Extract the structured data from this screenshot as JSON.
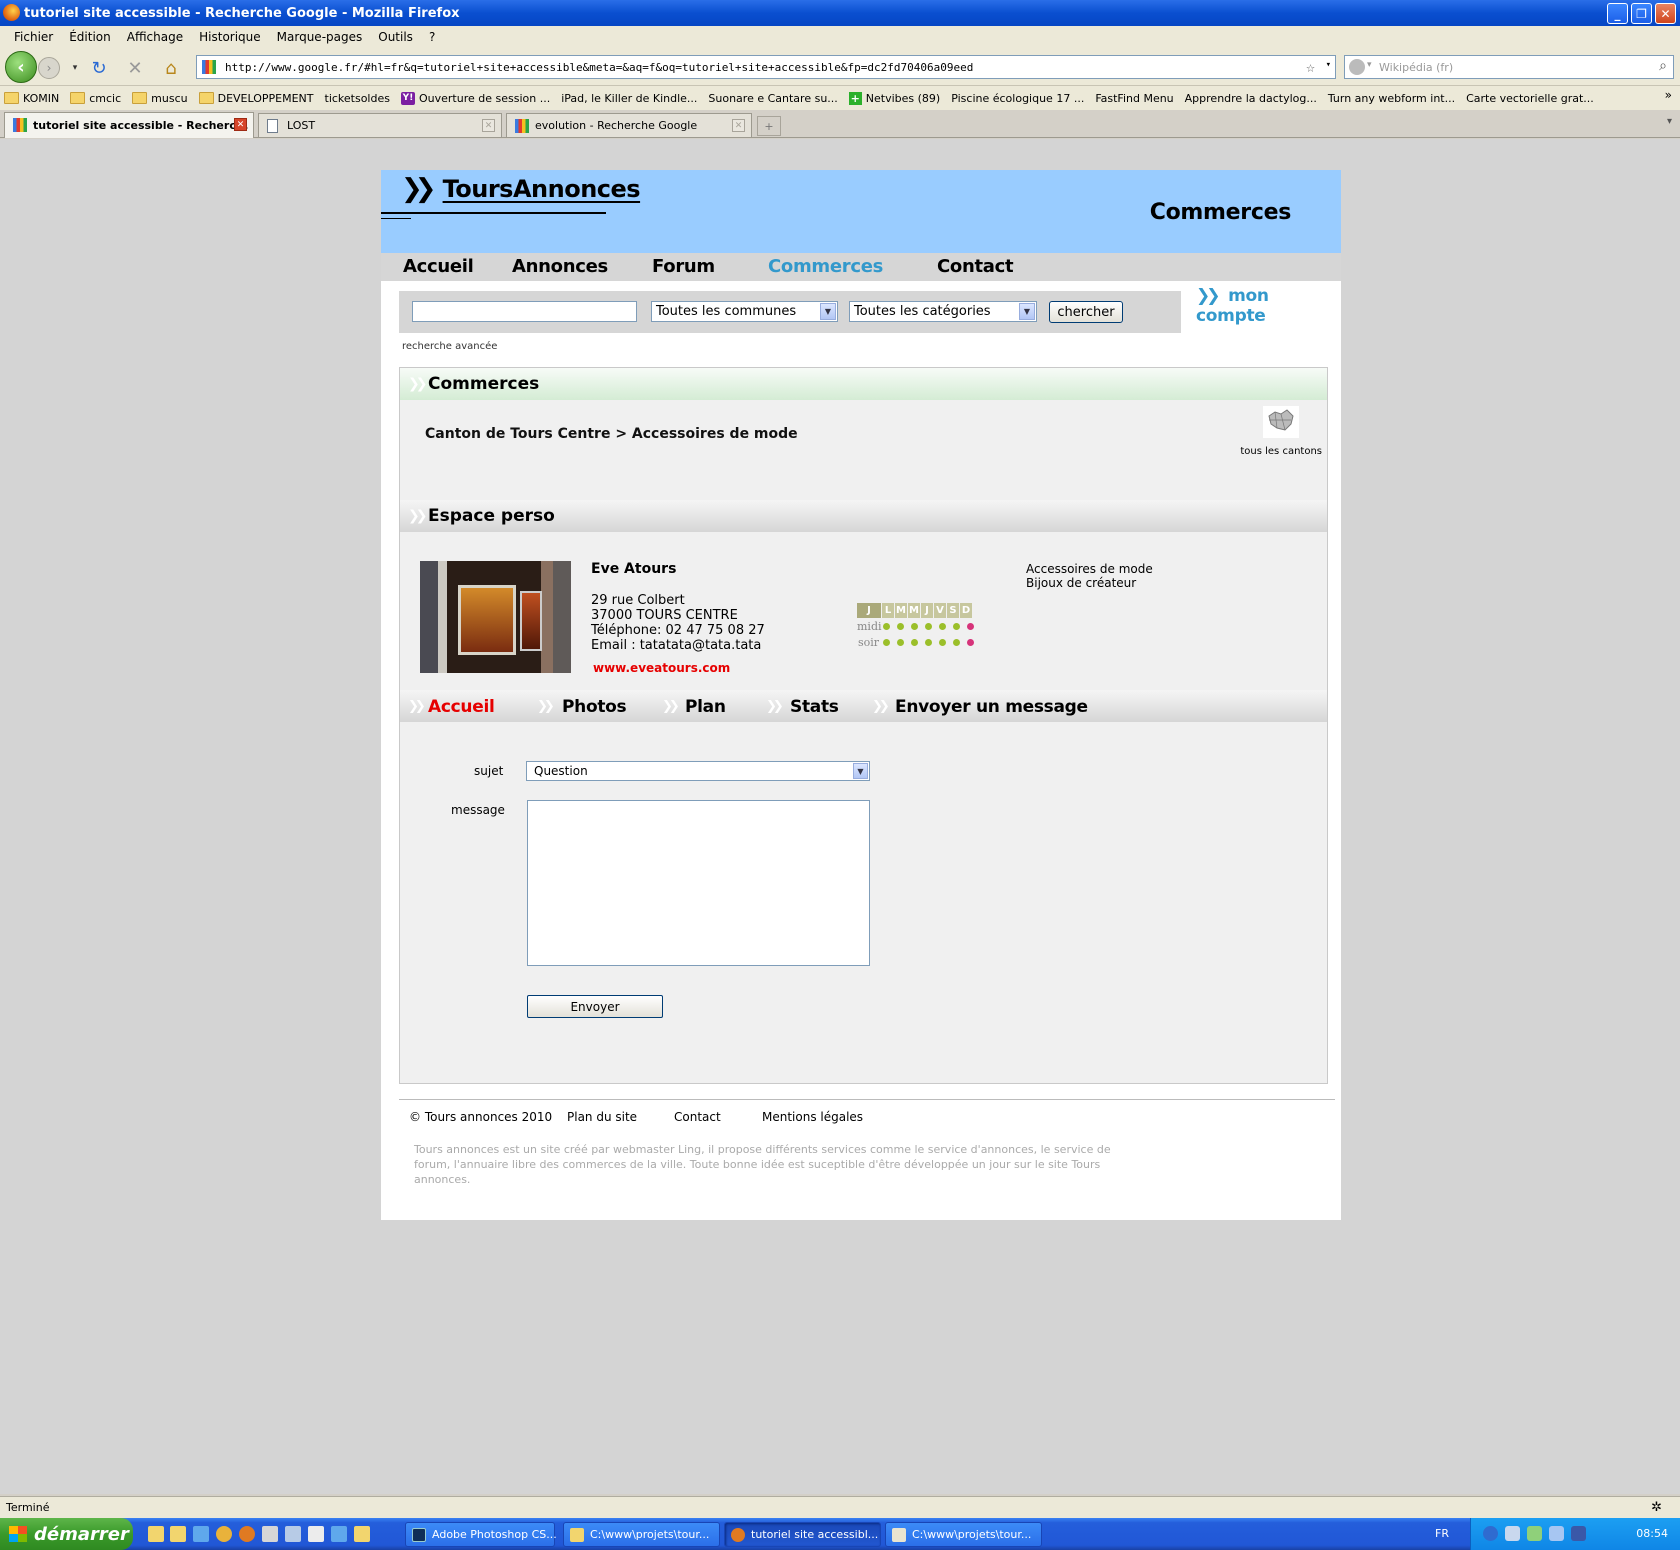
{
  "window": {
    "title": "tutoriel site accessible - Recherche Google - Mozilla Firefox"
  },
  "menu": [
    "Fichier",
    "Édition",
    "Affichage",
    "Historique",
    "Marque-pages",
    "Outils",
    "?"
  ],
  "url": "http://www.google.fr/#hl=fr&q=tutoriel+site+accessible&meta=&aq=f&oq=tutoriel+site+accessible&fp=dc2fd70406a09eed",
  "search_placeholder": "Wikipédia (fr)",
  "bookmarks": [
    {
      "label": "KOMIN",
      "icon": "folder-icon"
    },
    {
      "label": "cmcic",
      "icon": "folder-icon"
    },
    {
      "label": "muscu",
      "icon": "folder-icon"
    },
    {
      "label": "DEVELOPPEMENT",
      "icon": "folder-icon"
    },
    {
      "label": "ticketsoldes",
      "icon": "page-icon"
    },
    {
      "label": "Ouverture de session ...",
      "icon": "yahoo-icon"
    },
    {
      "label": "iPad, le Killer de Kindle...",
      "icon": "page-icon"
    },
    {
      "label": "Suonare e Cantare su...",
      "icon": "page-icon"
    },
    {
      "label": "Netvibes (89)",
      "icon": "netvibes-icon"
    },
    {
      "label": "Piscine écologique 17 ...",
      "icon": "page-icon"
    },
    {
      "label": "FastFind Menu",
      "icon": "page-icon"
    },
    {
      "label": "Apprendre la dactylog...",
      "icon": "page-icon"
    },
    {
      "label": "Turn any webform int...",
      "icon": "page-icon"
    },
    {
      "label": "Carte vectorielle grat...",
      "icon": "page-icon"
    }
  ],
  "tabs": [
    {
      "label": "tutoriel site accessible - Recherc...",
      "active": true
    },
    {
      "label": "LOST",
      "active": false
    },
    {
      "label": "evolution - Recherche Google",
      "active": false
    }
  ],
  "site": {
    "logo": "ToursAnnonces",
    "header_title": "Commerces",
    "nav": [
      "Accueil",
      "Annonces",
      "Forum",
      "Commerces",
      "Contact"
    ],
    "nav_active": "Commerces",
    "search": {
      "commune": "Toutes les communes",
      "category": "Toutes les catégories",
      "button": "chercher"
    },
    "account": "mon compte",
    "advanced_search": "recherche avancée",
    "section1_title": "Commerces",
    "breadcrumb": "Canton de Tours Centre > Accessoires de mode",
    "all_cantons": "tous les cantons",
    "section2_title": "Espace perso",
    "shop": {
      "name": "Eve Atours",
      "address1": "29 rue Colbert",
      "address2": "37000 TOURS CENTRE",
      "phone": "Téléphone: 02 47 75 08 27",
      "email": "Email : tatatata@tata.tata",
      "website": "www.eveatours.com",
      "categories": [
        "Accessoires de mode",
        "Bijoux de créateur"
      ]
    },
    "hours": {
      "days": [
        "J",
        "L",
        "M",
        "M",
        "J",
        "V",
        "S",
        "D"
      ],
      "rows": [
        "midi",
        "soir"
      ]
    },
    "shop_tabs": [
      "Accueil",
      "Photos",
      "Plan",
      "Stats",
      "Envoyer un message"
    ],
    "shop_tab_active": "Accueil",
    "form": {
      "subject_label": "sujet",
      "subject_value": "Question",
      "message_label": "message",
      "submit": "Envoyer"
    },
    "footer": {
      "copyright": "© Tours annonces 2010",
      "links": [
        "Plan du site",
        "Contact",
        "Mentions légales"
      ],
      "text": "Tours annonces est un site créé par webmaster Ling, il propose différents services comme le service d'annonces, le service de forum, l'annuaire libre des commerces de la ville. Toute bonne idée est suceptible d'être développée un jour sur le site Tours annonces."
    }
  },
  "status": "Terminé",
  "taskbar": {
    "start": "démarrer",
    "tasks": [
      {
        "label": "Adobe Photoshop CS...",
        "active": false
      },
      {
        "label": "C:\\www\\projets\\tour...",
        "active": false
      },
      {
        "label": "tutoriel site accessibl...",
        "active": true
      },
      {
        "label": "C:\\www\\projets\\tour...",
        "active": false
      }
    ],
    "lang": "FR",
    "clock": "08:54"
  }
}
